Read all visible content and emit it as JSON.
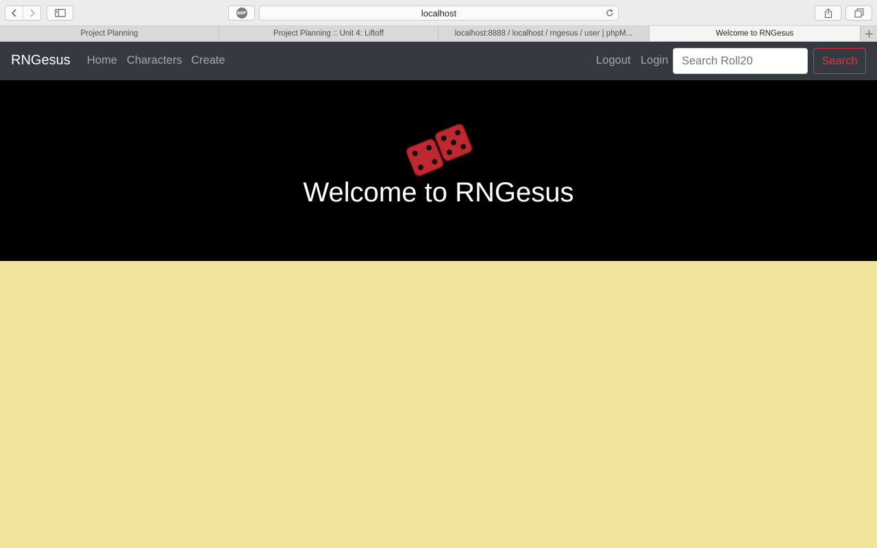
{
  "browser": {
    "url": "localhost",
    "adblock_label": "ABP",
    "tabs": [
      {
        "label": "Project Planning",
        "active": false
      },
      {
        "label": "Project Planning :: Unit 4: Liftoff",
        "active": false
      },
      {
        "label": "localhost:8888 / localhost / rngesus / user | phpM...",
        "active": false
      },
      {
        "label": "Welcome to RNGesus",
        "active": true
      }
    ],
    "icons": [
      "back-icon",
      "forward-icon",
      "sidebar-icon",
      "adblock-icon",
      "reload-icon",
      "share-icon",
      "tabs-overview-icon",
      "new-tab-icon"
    ]
  },
  "navbar": {
    "brand": "RNGesus",
    "links": [
      "Home",
      "Characters",
      "Create"
    ],
    "right_links": [
      "Logout",
      "Login"
    ],
    "search_placeholder": "Search Roll20",
    "search_button": "Search",
    "background": "#343a40",
    "accent": "#dc3545"
  },
  "hero": {
    "icon": "dice-icon",
    "title": "Welcome to RNGesus",
    "background": "#000000",
    "icon_color": "#c0282f"
  },
  "page": {
    "background": "#f0e49a"
  }
}
